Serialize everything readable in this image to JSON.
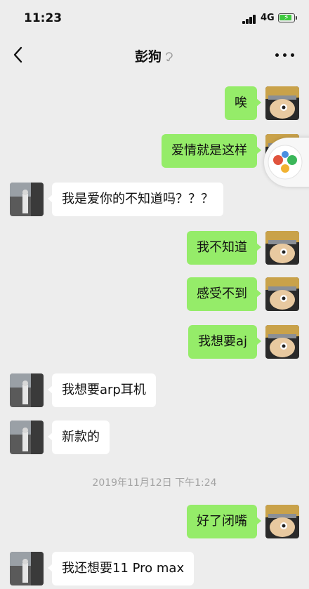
{
  "status_bar": {
    "time": "11:23",
    "network": "4G",
    "battery_icon": "battery-charging-icon"
  },
  "nav": {
    "title": "彭狗",
    "back_icon": "chevron-left-icon",
    "more_icon": "more-icon",
    "ear_icon": "earpiece-icon"
  },
  "colors": {
    "background": "#ededed",
    "bubble_out": "#95ec69",
    "bubble_in": "#ffffff",
    "timestamp": "#a3a3a3"
  },
  "messages": [
    {
      "side": "out",
      "text": "唉"
    },
    {
      "side": "out",
      "text": "爱情就是这样"
    },
    {
      "side": "in",
      "text": "我是爱你的不知道吗？？？"
    },
    {
      "side": "out",
      "text": "我不知道"
    },
    {
      "side": "out",
      "text": "感受不到"
    },
    {
      "side": "out",
      "text": "我想要aj"
    },
    {
      "side": "in",
      "text": "我想要arp耳机"
    },
    {
      "side": "in",
      "text": "新款的"
    },
    {
      "side": "out",
      "text": "好了闭嘴"
    },
    {
      "side": "in",
      "text": "我还想要11 Pro max"
    }
  ],
  "timestamp": "2019年11月12日 下午1:24"
}
